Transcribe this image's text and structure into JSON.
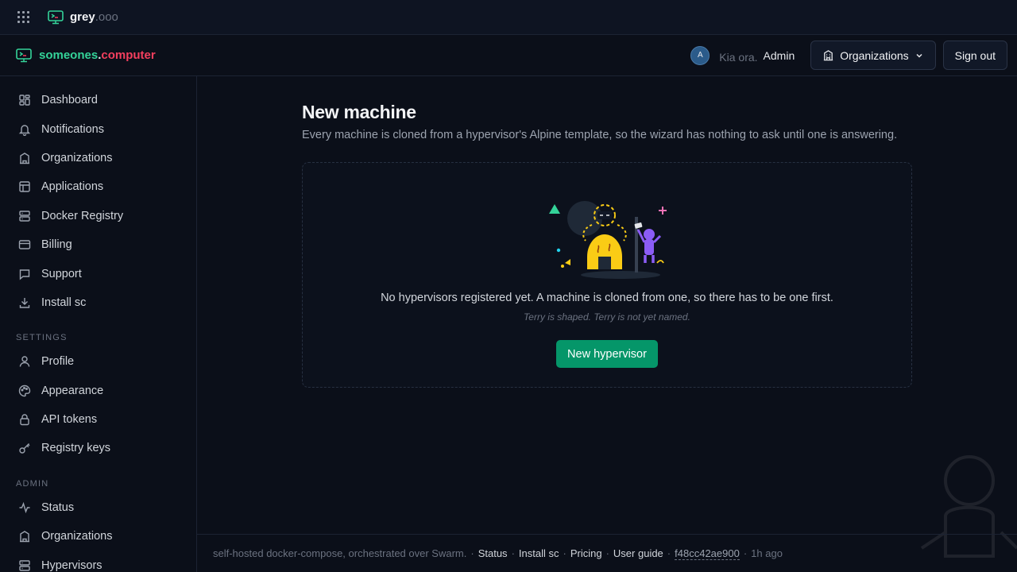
{
  "topbar": {
    "brand_name": "grey",
    "brand_tld": ".ooo"
  },
  "header": {
    "brand_part1": "someones",
    "brand_dot": ".",
    "brand_part2": "computer",
    "avatar_initial": "A",
    "greeting": "Kia ora.",
    "role": "Admin",
    "organizations_label": "Organizations",
    "sign_out_label": "Sign out"
  },
  "sidebar": {
    "main_items": [
      {
        "label": "Dashboard",
        "icon": "dashboard-icon"
      },
      {
        "label": "Notifications",
        "icon": "bell-icon"
      },
      {
        "label": "Organizations",
        "icon": "building-icon"
      },
      {
        "label": "Applications",
        "icon": "layout-icon"
      },
      {
        "label": "Docker Registry",
        "icon": "server-icon"
      },
      {
        "label": "Billing",
        "icon": "credit-card-icon"
      },
      {
        "label": "Support",
        "icon": "message-icon"
      },
      {
        "label": "Install sc",
        "icon": "download-icon"
      }
    ],
    "settings_heading": "SETTINGS",
    "settings_items": [
      {
        "label": "Profile",
        "icon": "user-icon"
      },
      {
        "label": "Appearance",
        "icon": "palette-icon"
      },
      {
        "label": "API tokens",
        "icon": "lock-icon"
      },
      {
        "label": "Registry keys",
        "icon": "key-icon"
      }
    ],
    "admin_heading": "ADMIN",
    "admin_items": [
      {
        "label": "Status",
        "icon": "activity-icon"
      },
      {
        "label": "Organizations",
        "icon": "building-icon"
      },
      {
        "label": "Hypervisors",
        "icon": "server-icon"
      }
    ]
  },
  "main": {
    "title": "New machine",
    "subtitle": "Every machine is cloned from a hypervisor's Alpine template, so the wizard has nothing to ask until one is answering.",
    "empty_message": "No hypervisors registered yet. A machine is cloned from one, so there has to be one first.",
    "empty_caption": "Terry is shaped. Terry is not yet named.",
    "new_hypervisor_label": "New hypervisor"
  },
  "footer": {
    "description": "self-hosted docker-compose, orchestrated over Swarm.",
    "links": [
      "Status",
      "Install sc",
      "Pricing",
      "User guide"
    ],
    "commit": "f48cc42ae900",
    "age": "1h ago"
  },
  "colors": {
    "accent_green": "#059669",
    "brand_green": "#34d399",
    "brand_red": "#f43f5e",
    "background": "#0b0f19"
  }
}
